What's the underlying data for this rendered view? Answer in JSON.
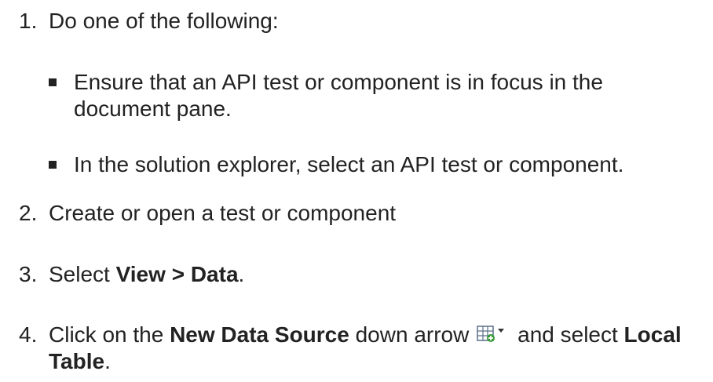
{
  "steps": [
    {
      "number": "1.",
      "text": "Do one of the following:"
    },
    {
      "number": "2.",
      "text": "Create or open a test or component"
    },
    {
      "number": "3.",
      "prefix": "Select ",
      "bold": "View > Data",
      "suffix": "."
    },
    {
      "number": "4.",
      "prefix": "Click on the ",
      "bold": "New Data Source",
      "middle": " down arrow",
      "after_icon": " and select ",
      "bold2": "Local Table",
      "suffix": "."
    }
  ],
  "bullets": [
    {
      "text": "Ensure that an API test or component is in focus in the document pane."
    },
    {
      "text": "In the solution explorer, select an API test or component."
    }
  ],
  "icons": {
    "new_data_source": "table-add-icon",
    "dropdown": "dropdown-arrow-icon"
  },
  "colors": {
    "text": "#222222",
    "icon_green": "#3a9a3a"
  }
}
